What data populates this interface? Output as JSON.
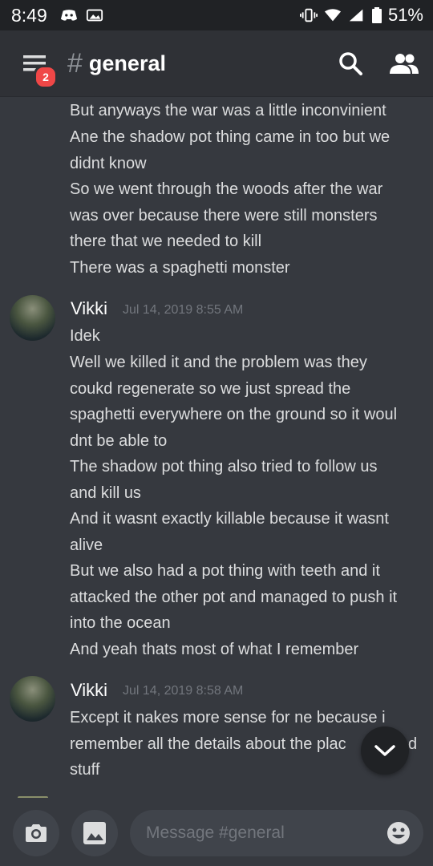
{
  "status_bar": {
    "time": "8:49",
    "battery": "51%"
  },
  "header": {
    "hash": "#",
    "channel": "general",
    "notification_count": "2"
  },
  "continuation_lines": [
    "But anyways the war was a little inconvinient",
    "Ane the shadow pot thing came in too but we",
    "didnt know",
    "So we went through the woods after the war",
    "was over because there were still monsters",
    "there that we needed to kill",
    "There was a spaghetti monster"
  ],
  "message_groups": [
    {
      "author": "Vikki",
      "timestamp": "Jul 14, 2019 8:55 AM",
      "lines": [
        "Idek",
        "Well we killed it and the problem was they",
        "coukd regenerate so we just spread the",
        "spaghetti everywhere on the ground so it woul",
        "dnt be able to",
        "The shadow pot thing also tried to follow us",
        "and kill us",
        "And it wasnt exactly killable because it wasnt",
        "alive",
        "But we also had a pot thing with teeth and it",
        "attacked the other pot and managed to push it",
        "into the ocean",
        "And yeah thats most of what I remember"
      ]
    },
    {
      "author": "Vikki",
      "timestamp": "Jul 14, 2019 8:58 AM",
      "lines": [
        "Except it nakes more sense for ne because i",
        "remember all the details about the plac",
        "stuff"
      ]
    }
  ],
  "partial_text": "d",
  "composer": {
    "placeholder": "Message #general"
  },
  "icons": {
    "menu": "hamburger-menu-icon",
    "search": "search-icon",
    "members": "members-icon",
    "camera": "camera-icon",
    "image": "image-icon",
    "emoji": "emoji-icon",
    "scroll_down": "chevron-down-icon"
  },
  "colors": {
    "background": "#36393f",
    "header": "#2f3136",
    "badge": "#f04747",
    "text": "#dcddde",
    "timestamp": "#72767d"
  }
}
